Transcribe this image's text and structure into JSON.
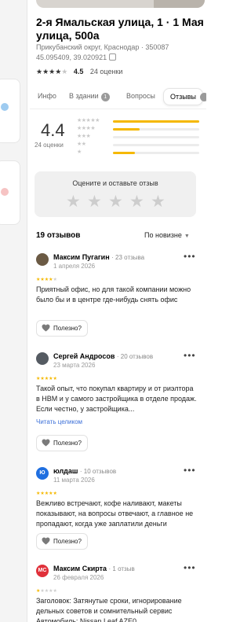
{
  "place": {
    "title": "2-я Ямальская улица, 1 · 1 Мая улица, 500а",
    "address": "Прикубанский округ, Краснодар · 350087",
    "coords": "45.095409, 39.020921",
    "rating": "4.5",
    "rating_count": "24 оценки"
  },
  "tabs": [
    {
      "label": "Инфо"
    },
    {
      "label": "В здании",
      "badge": "1"
    },
    {
      "label": "Вопросы"
    },
    {
      "label": "Отзывы"
    }
  ],
  "summary": {
    "score": "4.4",
    "score_caption": "24 оценки",
    "distribution": [
      {
        "stars": 5,
        "fraction": 1.0
      },
      {
        "stars": 4,
        "fraction": 0.31
      },
      {
        "stars": 3,
        "fraction": 0.0
      },
      {
        "stars": 2,
        "fraction": 0.0
      },
      {
        "stars": 1,
        "fraction": 0.25
      }
    ]
  },
  "rate_prompt": {
    "title": "Оцените и оставьте отзыв"
  },
  "reviews_header": {
    "count_label": "19 отзывов",
    "sort_label": "По новизне"
  },
  "helpful_label": "Полезно?",
  "reviews": [
    {
      "name": "Максим Пугагин",
      "meta": "· 23 отзыва",
      "date": "1 апреля 2026",
      "stars": 4,
      "avatar": "photo",
      "avatar_color": "#6b5a44",
      "text": "Приятный офис, но для такой компании можно было бы и в центре где-нибудь снять офис"
    },
    {
      "name": "Сергей Андросов",
      "meta": "· 20 отзывов",
      "date": "23 марта 2026",
      "stars": 5,
      "avatar": "photo",
      "avatar_color": "#555b62",
      "text": "Такой опыт, что покупал квартиру и от риэлтора в НВМ и у самого застройщика в отделе продаж. Если честно, у застройщика...",
      "link": "Читать целиком"
    },
    {
      "name": "юлдаш",
      "meta": "· 10 отзывов",
      "date": "11 марта 2026",
      "stars": 5,
      "avatar": "Ю",
      "avatar_color": "#1f6fe0",
      "text": "Вежливо встречают, кофе наливают, макеты показывают, на вопросы отвечают, а главное не пропадают, когда уже заплатили деньги"
    },
    {
      "name": "Максим Скирта",
      "meta": "· 1 отзыв",
      "date": "26 февраля 2026",
      "stars": 1,
      "avatar": "МС",
      "avatar_color": "#e0303a",
      "text": "Заголовок: Затянутые сроки, игнорирование дельных советов и сомнительный сервис Автомобиль: Nissan Leaf AZE0"
    }
  ],
  "colors": {
    "star_active": "#f5b800",
    "star_inactive": "#cdcdcd",
    "link": "#3b6fd8"
  }
}
